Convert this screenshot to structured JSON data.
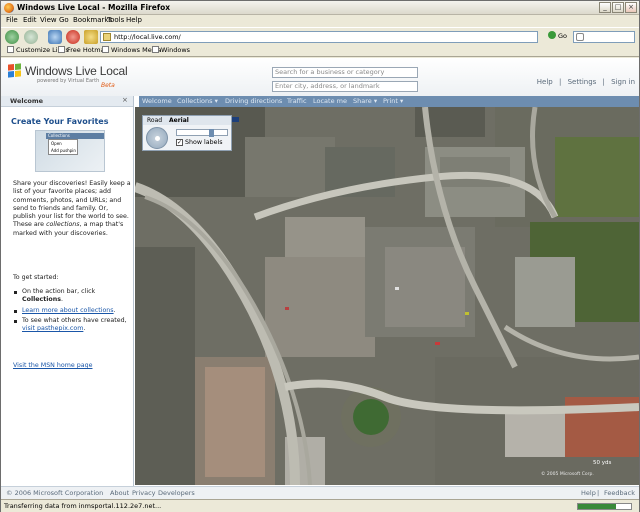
{
  "window": {
    "title": "Windows Live Local - Mozilla Firefox"
  },
  "menu": [
    "File",
    "Edit",
    "View",
    "Go",
    "Bookmarks",
    "Tools",
    "Help"
  ],
  "nav": {
    "url": "http://local.live.com/",
    "go_label": "Go"
  },
  "bookmarks": [
    "Customize Links",
    "Free Hotmail",
    "Windows Media",
    "Windows"
  ],
  "site": {
    "logo_text": "Windows Live Local",
    "logo_sub": "powered by Virtual Earth",
    "logo_beta": "Beta",
    "search_business_placeholder": "Search for a business or category",
    "search_location_placeholder": "Enter city, address, or landmark",
    "top_links": [
      "Help",
      "|",
      "Settings",
      "|",
      "Sign in"
    ]
  },
  "actionbar": [
    "Welcome",
    "Collections ▾",
    "Driving directions",
    "Traffic",
    "Locate me",
    "Share ▾",
    "Print ▾"
  ],
  "panel": {
    "header": "Welcome",
    "close": "×",
    "title": "Create Your Favorites",
    "illus_items": [
      "Collections",
      "Open",
      "Add pushpin"
    ],
    "intro_1": "Share your discoveries! Easily keep a list of your favorite places; add comments, photos, and URLs; and send to friends and family. Or, publish your list for the world to see. These are",
    "intro_em": "collections",
    "intro_2": ", a map that's marked with your discoveries.",
    "get_started": "To get started:",
    "step1_pre": "On the action bar, click ",
    "step1_bold": "Collections",
    "step1_post": ".",
    "step2_link": "Learn more about collections",
    "step2_post": ".",
    "step3": "To see what others have created,",
    "step3_link": "visit pasthepix.com",
    "step3_post": ".",
    "msn_link": "Visit the MSN home page"
  },
  "map_panel": {
    "tab_road": "Road",
    "tab_aerial": "Aerial",
    "show_labels": "Show labels",
    "checked_mark": "✓",
    "zoom_level": 0.68
  },
  "map": {
    "scale_label": "50 yds",
    "copyright": "© 2005 Microsoft Corp."
  },
  "footer": {
    "left": [
      "© 2006 Microsoft Corporation",
      "About",
      "Privacy",
      "Developers"
    ],
    "right": [
      "Help",
      "|",
      "Feedback"
    ]
  },
  "status": {
    "text": "Transferring data from inmsportal.112.2e7.net...",
    "progress": 0.72
  }
}
